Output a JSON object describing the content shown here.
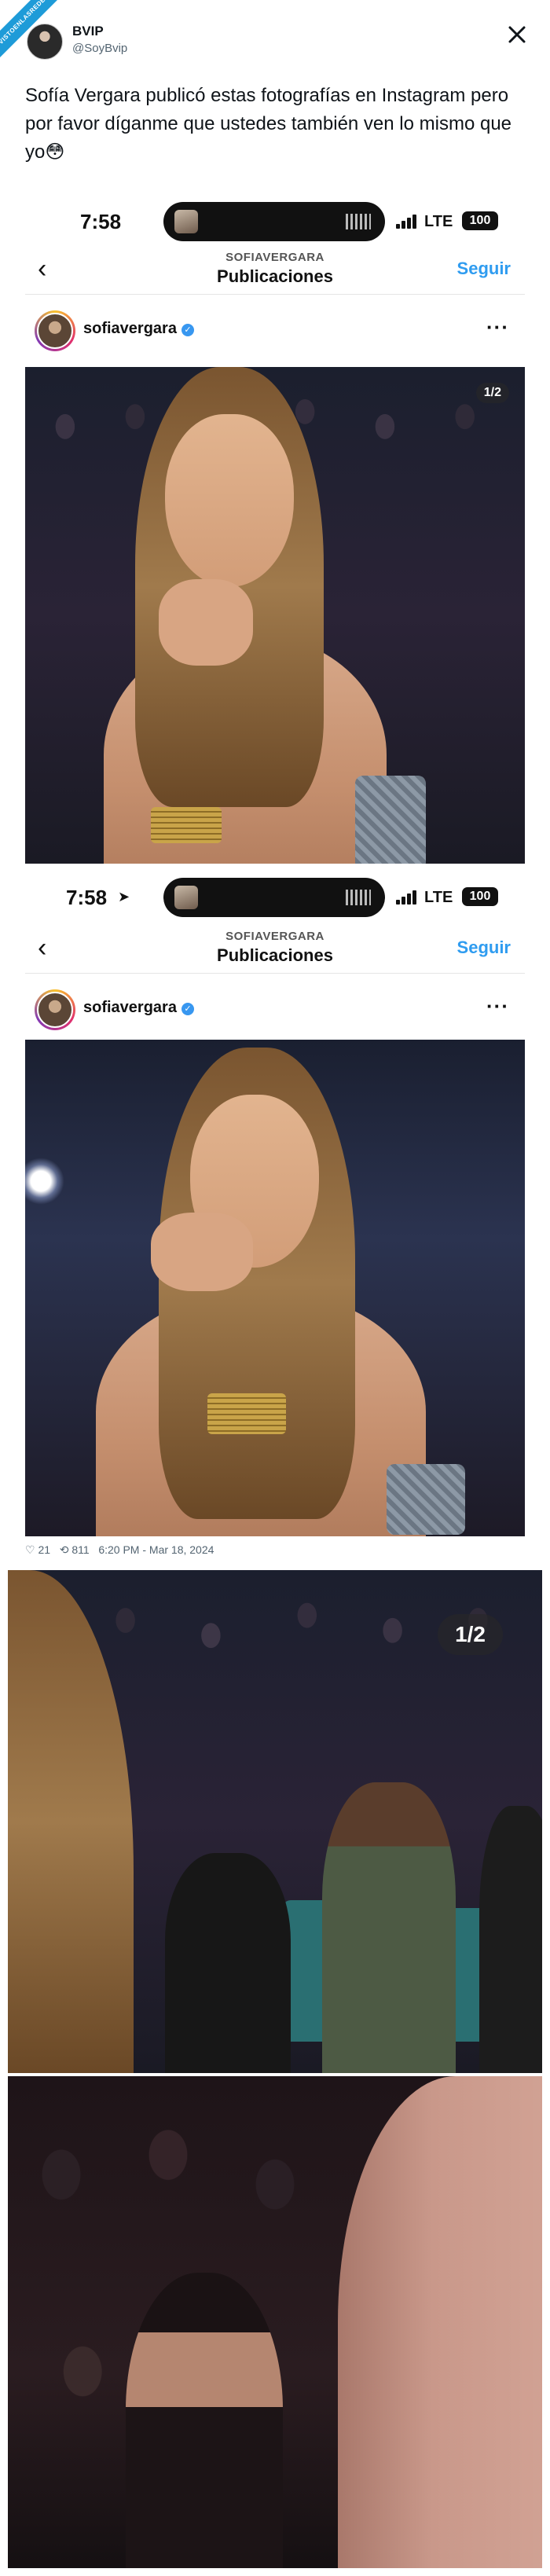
{
  "tweet": {
    "badge": "VISTOENLASREDES",
    "author_name": "BVIP",
    "author_handle": "@SoyBvip",
    "text": "Sofía Vergara publicó estas fotografías en Instagram pero por favor díganme que ustedes también ven lo mismo que yo😳",
    "likes": "21",
    "retweets": "811",
    "timestamp": "6:20 PM - Mar 18, 2024"
  },
  "shot1": {
    "time": "7:58",
    "network": "LTE",
    "battery": "100",
    "nav_subtitle": "SOFIAVERGARA",
    "nav_title": "Publicaciones",
    "follow_label": "Seguir",
    "username": "sofiavergara",
    "photo_counter": "1/2"
  },
  "shot2": {
    "time": "7:58",
    "network": "LTE",
    "battery": "100",
    "nav_subtitle": "SOFIAVERGARA",
    "nav_title": "Publicaciones",
    "follow_label": "Seguir",
    "username": "sofiavergara"
  },
  "zoom1": {
    "photo_counter": "1/2"
  },
  "icons": {
    "x_logo": "x-logo-icon",
    "back": "chevron-left-icon",
    "more": "more-horizontal-icon",
    "verified": "verified-icon",
    "heart": "heart-icon",
    "retweet": "retweet-icon"
  },
  "colors": {
    "follow_blue": "#2f9cf0",
    "verified_blue": "#3897f0",
    "badge_blue": "#1e9bd8"
  }
}
